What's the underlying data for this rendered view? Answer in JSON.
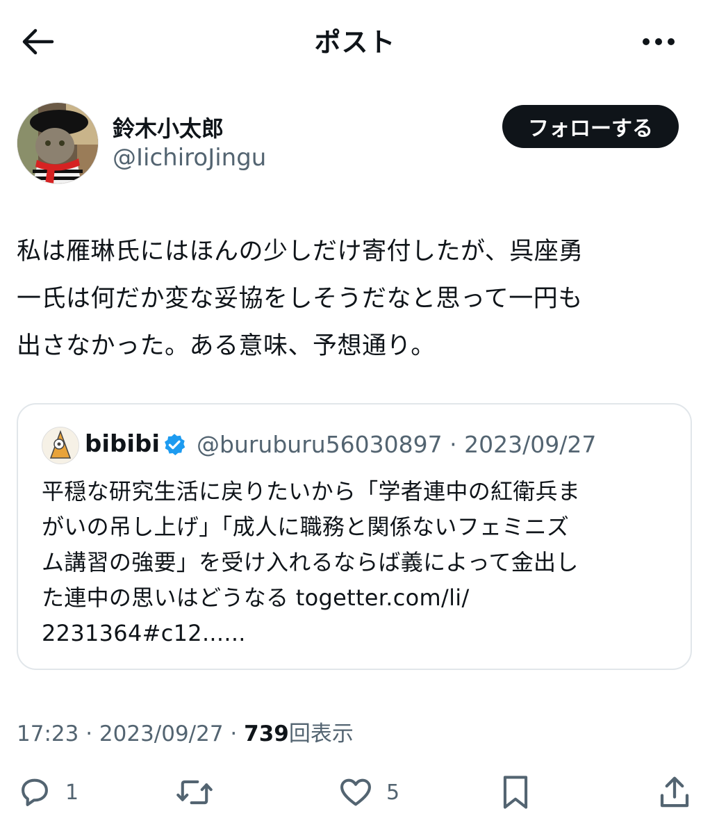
{
  "header": {
    "title": "ポスト"
  },
  "author": {
    "display_name": "鈴木小太郎",
    "handle": "@IichiroJingu",
    "follow_label": "フォローする"
  },
  "tweet": {
    "text_lines": [
      "私は雁琳氏にはほんの少しだけ寄付したが、呉座勇",
      "一氏は何だか変な妥協をしそうだなと思って一円も",
      "出さなかった。ある意味、予想通り。"
    ]
  },
  "quote": {
    "display_name": "bibibi",
    "meta": "@buruburu56030897 · 2023/09/27",
    "text_lines": [
      "平穏な研究生活に戻りたいから「学者連中の紅衛兵ま",
      "がいの吊し上げ」「成人に職務と関係ないフェミニズ",
      "ム講習の強要」を受け入れるならば義によって金出し",
      "た連中の思いはどうなる togetter.com/li/",
      "2231364#c12......"
    ]
  },
  "meta": {
    "time_date": "17:23 · 2023/09/27 · ",
    "views_count": "739",
    "views_label": "回表示"
  },
  "actions": {
    "reply_count": "1",
    "like_count": "5"
  },
  "colors": {
    "text": "#0f1419",
    "secondary": "#536471",
    "verified": "#1d9bf0",
    "border": "#e1e6ea"
  },
  "icons": [
    "arrow-left-icon",
    "more-horizontal-icon",
    "verified-badge-icon",
    "reply-icon",
    "repost-icon",
    "like-icon",
    "bookmark-icon",
    "share-icon"
  ]
}
